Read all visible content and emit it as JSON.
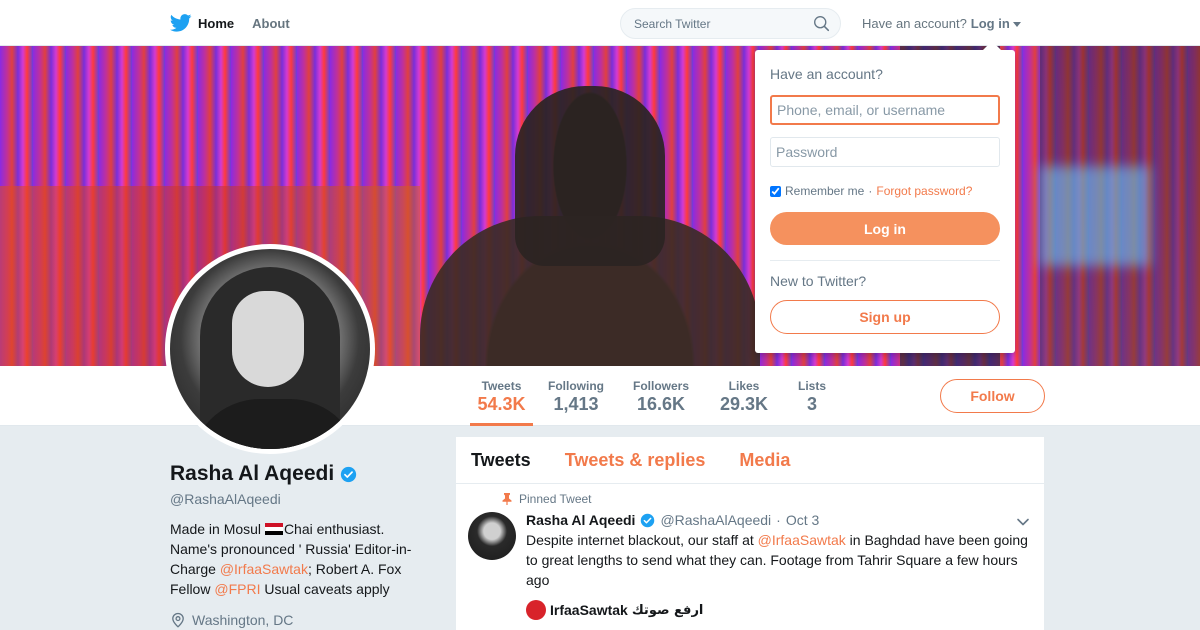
{
  "nav": {
    "home_label": "Home",
    "about_label": "About",
    "search_placeholder": "Search Twitter",
    "account_prompt": "Have an account?",
    "login_label": "Log in",
    "icons": [
      "twitter-bird-icon",
      "search-icon",
      "chevron-down-icon"
    ]
  },
  "login_dropdown": {
    "title": "Have an account?",
    "username_placeholder": "Phone, email, or username",
    "password_placeholder": "Password",
    "remember_label": "Remember me",
    "separator": "·",
    "forgot_label": "Forgot password?",
    "remember_checked": true,
    "login_button": "Log in",
    "new_prompt": "New to Twitter?",
    "signup_button": "Sign up"
  },
  "profile": {
    "name": "Rasha Al Aqeedi",
    "handle": "@RashaAlAqeedi",
    "verified": true,
    "bio_part1": "Made in Mosul ",
    "bio_part2": "Chai enthusiast. Name's pronounced ' Russia' Editor-in-Charge ",
    "bio_link1": "@IrfaaSawtak",
    "bio_part3": "; Robert A. Fox Fellow ",
    "bio_link2": "@FPRI",
    "bio_part4": " Usual caveats apply",
    "location": "Washington, DC",
    "follow_button": "Follow"
  },
  "stats": [
    {
      "label": "Tweets",
      "value": "54.3K",
      "active": true
    },
    {
      "label": "Following",
      "value": "1,413",
      "active": false
    },
    {
      "label": "Followers",
      "value": "16.6K",
      "active": false
    },
    {
      "label": "Likes",
      "value": "29.3K",
      "active": false
    },
    {
      "label": "Lists",
      "value": "3",
      "active": false
    }
  ],
  "timeline": {
    "tabs": [
      "Tweets",
      "Tweets & replies",
      "Media"
    ],
    "pinned_label": "Pinned Tweet",
    "tweet": {
      "name": "Rasha Al Aqeedi",
      "handle": "@RashaAlAqeedi",
      "dot": "·",
      "time": "Oct 3",
      "text_part1": "Despite internet blackout, our staff at ",
      "text_link": "@IrfaaSawtak",
      "text_part2": " in Baghdad have been going to great lengths to send what they can. Footage from Tahrir Square a few hours ago",
      "quote_name": "IrfaaSawtak",
      "quote_arabic": "ارفع صوتك"
    }
  },
  "colors": {
    "accent": "#f27a4b",
    "verified": "#1da1f2",
    "twitter_blue": "#1da1f2"
  }
}
